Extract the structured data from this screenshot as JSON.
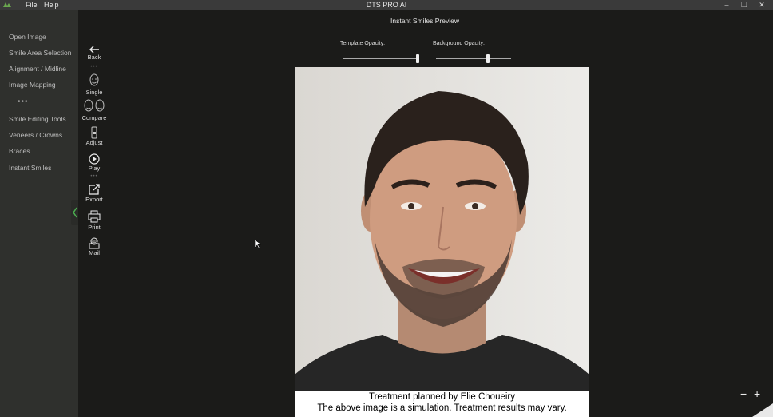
{
  "app": {
    "title": "DTS PRO AI",
    "menu": [
      "File",
      "Help"
    ],
    "window_controls": [
      "minimize-icon",
      "restore-icon",
      "close-icon"
    ]
  },
  "sidebar": {
    "items": [
      {
        "label": "Open Image"
      },
      {
        "label": "Smile Area Selection"
      },
      {
        "label": "Alignment / Midline"
      },
      {
        "label": "Image Mapping"
      },
      {
        "label": "Smile Editing Tools"
      },
      {
        "label": "Veneers / Crowns"
      },
      {
        "label": "Braces"
      },
      {
        "label": "Instant Smiles"
      }
    ],
    "more_label": "•••"
  },
  "toolbar": {
    "back_label": "Back",
    "single_label": "Single",
    "compare_label": "Compare",
    "adjust_label": "Adjust",
    "play_label": "Play",
    "export_label": "Export",
    "print_label": "Print",
    "mail_label": "Mail"
  },
  "preview": {
    "title": "Instant Smiles Preview",
    "template_opacity_label": "Template Opacity:",
    "background_opacity_label": "Background Opacity:",
    "template_opacity": 0.98,
    "background_opacity": 0.7,
    "caption_line1": "Treatment planned by Elie Choueiry",
    "caption_line2": "The above image is a simulation. Treatment results may vary."
  },
  "zoom": {
    "out_label": "−",
    "in_label": "+"
  },
  "colors": {
    "accent": "#4caf50",
    "panel": "#2f302d",
    "background": "#1b1b19"
  }
}
